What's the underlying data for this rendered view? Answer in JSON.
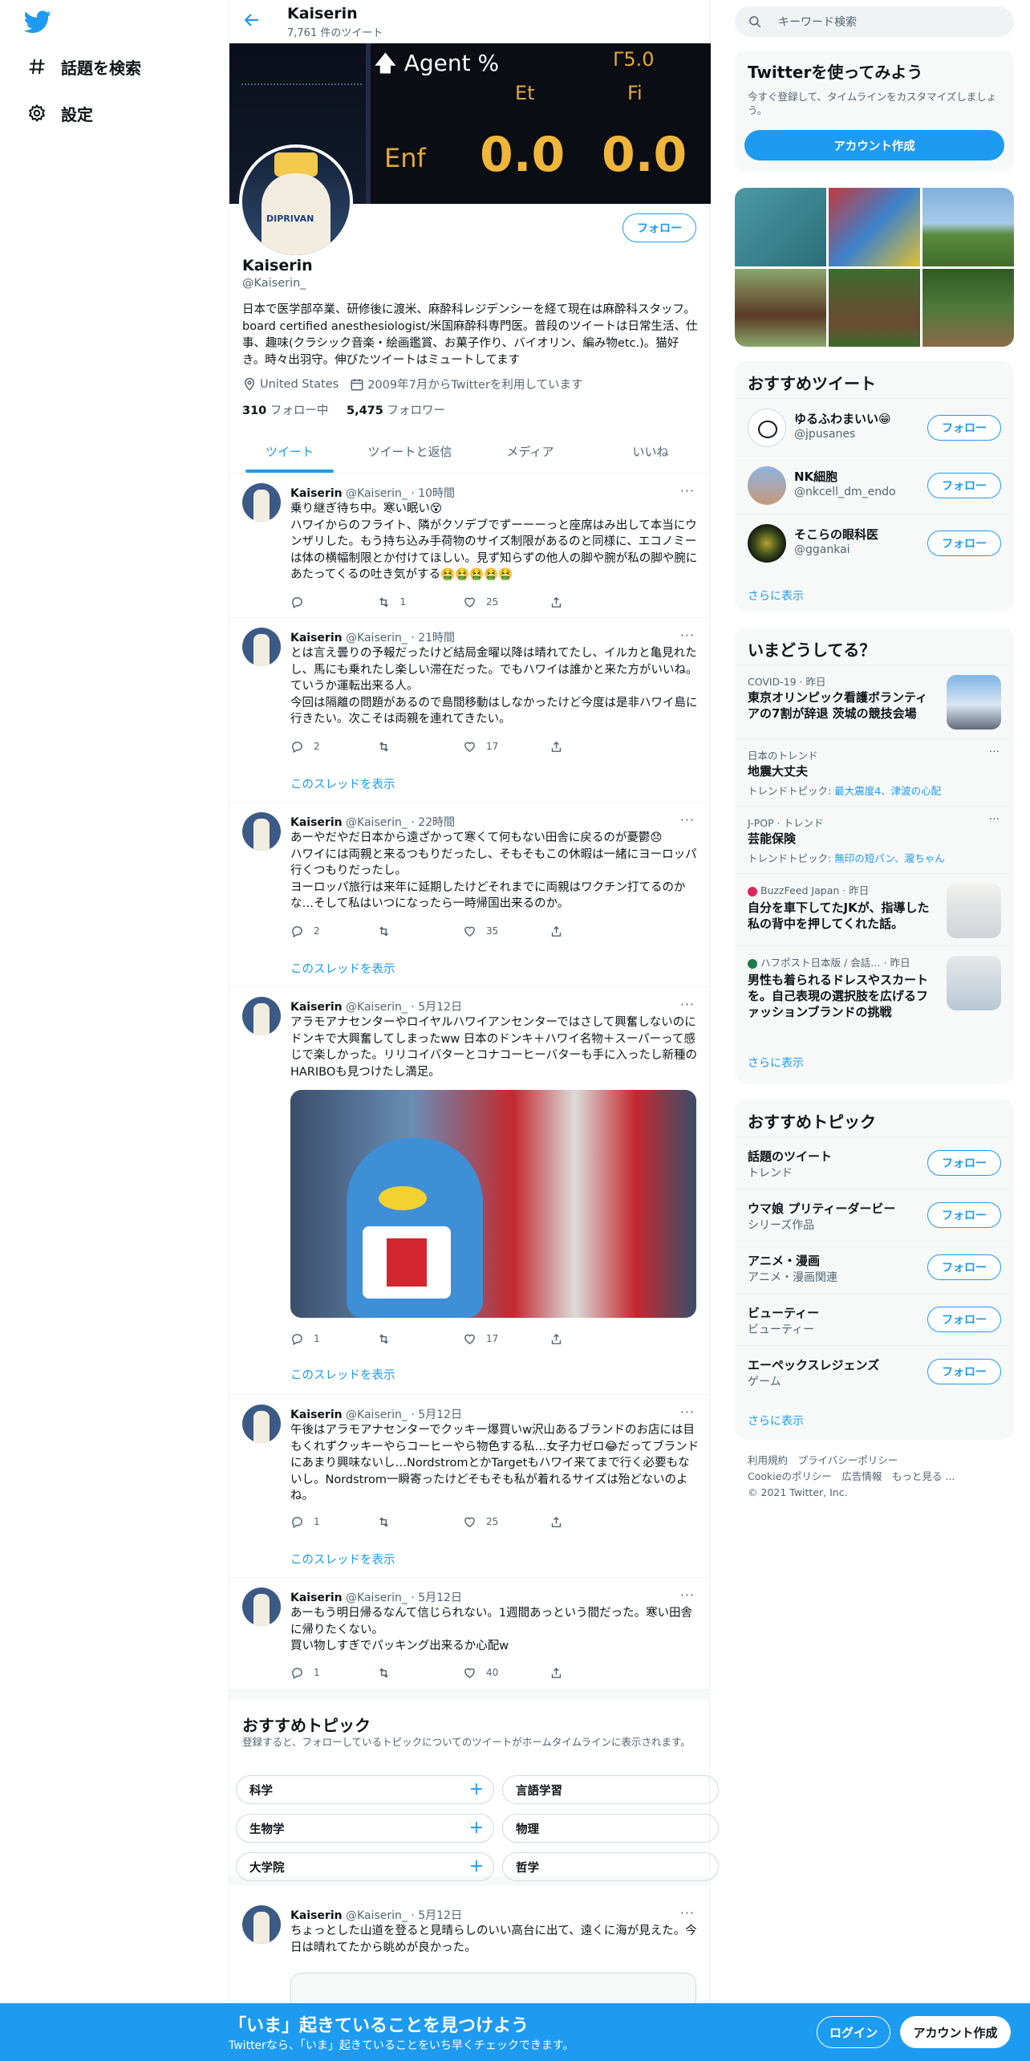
{
  "nav": {
    "explore": "話題を検索",
    "settings": "設定"
  },
  "header": {
    "name": "Kaiserin",
    "tweet_count": "7,761 件のツイート"
  },
  "banner": {
    "agent": "Agent %",
    "et": "Et",
    "fi": "Fi",
    "enf": "Enf",
    "val1": "0.0",
    "val2": "0.0",
    "top": "Γ5.0"
  },
  "profile": {
    "follow": "フォロー",
    "name": "Kaiserin",
    "handle": "@Kaiserin_",
    "bio": "日本で医学部卒業、研修後に渡米、麻酔科レジデンシーを経て現在は麻酔科スタッフ。board certified anesthesiologist/米国麻酔科専門医。普段のツイートは日常生活、仕事、趣味(クラシック音楽・絵画鑑賞、お菓子作り、バイオリン、編み物etc.)。猫好き。時々出羽守。伸びたツイートはミュートしてます",
    "location": "United States",
    "joined": "2009年7月からTwitterを利用しています",
    "following_count": "310",
    "following_label": " フォロー中",
    "followers_count": "5,475",
    "followers_label": " フォロワー",
    "avatar_label": "DIPRIVAN"
  },
  "tabs": [
    "ツイート",
    "ツイートと返信",
    "メディア",
    "いいね"
  ],
  "tweets": [
    {
      "name": "Kaiserin",
      "meta": " @Kaiserin_ · 10時間",
      "text": "乗り継ぎ待ち中。寒い眠い😵\nハワイからのフライト、隣がクソデブでずーーーっと座席はみ出して本当にウンザリした。もう持ち込み手荷物のサイズ制限があるのと同様に、エコノミーは体の横幅制限とか付けてほしい。見ず知らずの他人の脚や腕が私の脚や腕にあたってくるの吐き気がする🤮🤮🤮🤮🤮",
      "reply": "",
      "rt": "1",
      "like": "25",
      "thread": ""
    },
    {
      "name": "Kaiserin",
      "meta": " @Kaiserin_ · 21時間",
      "text": "とは言え曇りの予報だったけど結局金曜以降は晴れてたし、イルカと亀見れたし、馬にも乗れたし楽しい滞在だった。でもハワイは誰かと来た方がいいね。ていうか運転出来る人。\n今回は隔離の問題があるので島間移動はしなかったけど今度は是非ハワイ島に行きたい。次こそは両親を連れてきたい。",
      "reply": "2",
      "rt": "",
      "like": "17",
      "thread": "このスレッドを表示"
    },
    {
      "name": "Kaiserin",
      "meta": " @Kaiserin_ · 22時間",
      "text": "あーやだやだ日本から遠ざかって寒くて何もない田舎に戻るのが憂鬱😞\nハワイには両親と来るつもりだったし、そもそもこの休暇は一緒にヨーロッパ行くつもりだったし。\nヨーロッパ旅行は来年に延期したけどそれまでに両親はワクチン打てるのかな…そして私はいつになったら一時帰国出来るのか。",
      "reply": "2",
      "rt": "",
      "like": "35",
      "thread": "このスレッドを表示"
    },
    {
      "name": "Kaiserin",
      "meta": " @Kaiserin_ · 5月12日",
      "text": "アラモアナセンターやロイヤルハワイアンセンターではさして興奮しないのにドンキで大興奮してしまったww 日本のドンキ＋ハワイ名物＋スーパーって感じで楽しかった。リリコイバターとコナコーヒーバターも手に入ったし新種のHARIBOも見つけたし満足。",
      "reply": "1",
      "rt": "",
      "like": "17",
      "thread": "このスレッドを表示"
    },
    {
      "name": "Kaiserin",
      "meta": " @Kaiserin_ · 5月12日",
      "text": "午後はアラモアナセンターでクッキー爆買いw沢山あるブランドのお店には目もくれずクッキーやらコーヒーやら物色する私…女子力ゼロ😂だってブランドにあまり興味ないし…NordstromとかTargetもハワイ来てまで行く必要もないし。Nordstrom一瞬寄ったけどそもそも私が着れるサイズは殆どないのよね。",
      "reply": "1",
      "rt": "",
      "like": "25",
      "thread": "このスレッドを表示"
    },
    {
      "name": "Kaiserin",
      "meta": " @Kaiserin_ · 5月12日",
      "text": "あーもう明日帰るなんて信じられない。1週間あっという間だった。寒い田舎に帰りたくない。\n買い物しすぎでパッキング出来るか心配w",
      "reply": "1",
      "rt": "",
      "like": "40",
      "thread": ""
    },
    {
      "name": "Kaiserin",
      "meta": " @Kaiserin_ · 5月12日",
      "text": "ちょっとした山道を登ると見晴らしのいい高台に出て、遠くに海が見えた。今日は晴れてたから眺めが良かった。",
      "reply": "",
      "rt": "",
      "like": "",
      "thread": ""
    }
  ],
  "topics_inline": {
    "title": "おすすめトピック",
    "subtitle": "登録すると、フォローしているトピックについてのツイートがホームタイムラインに表示されます。",
    "items": [
      "科学",
      "言語学習",
      "生物学",
      "物理",
      "大学院",
      "哲学"
    ]
  },
  "right": {
    "search_placeholder": "キーワード検索",
    "signup": {
      "title": "Twitterを使ってみよう",
      "desc": "今すぐ登録して、タイムラインをカスタマイズしましょう。",
      "button": "アカウント作成"
    },
    "recs": {
      "title": "おすすめツイート",
      "items": [
        {
          "name": "ゆるふわまいい😁",
          "handle": "@jpusanes"
        },
        {
          "name": "NK細胞",
          "handle": "@nkcell_dm_endo"
        },
        {
          "name": "そこらの眼科医",
          "handle": "@ggankai"
        }
      ],
      "more": "さらに表示",
      "follow": "フォロー"
    },
    "trends": {
      "title": "いまどうしてる？",
      "items": [
        {
          "cat": "COVID-19 · 昨日",
          "title": "東京オリンピック看護ボランティアの7割が辞退 茨城の競技会場",
          "sub": ""
        },
        {
          "cat": "日本のトレンド",
          "title": "地震大丈夫",
          "sub_prefix": "トレンドトピック: ",
          "sub": "最大震度4、津波の心配"
        },
        {
          "cat": "J-POP · トレンド",
          "title": "芸能保険",
          "sub_prefix": "トレンドトピック: ",
          "sub": "無印の短パン、瀧ちゃん"
        },
        {
          "cat": "BuzzFeed Japan · 昨日",
          "title": "自分を車下してたJKが、指導した私の背中を押してくれた話。",
          "sub": ""
        },
        {
          "cat": "ハフポスト日本版 / 会話… · 昨日",
          "title": "男性も着られるドレスやスカートを。自己表現の選択肢を広げるファッションブランドの挑戦",
          "sub": ""
        }
      ],
      "more": "さらに表示"
    },
    "topics": {
      "title": "おすすめトピック",
      "items": [
        {
          "name": "話題のツイート",
          "cat": "トレンド"
        },
        {
          "name": "ウマ娘 プリティーダービー",
          "cat": "シリーズ作品"
        },
        {
          "name": "アニメ・漫画",
          "cat": "アニメ・漫画関連"
        },
        {
          "name": "ビューティー",
          "cat": "ビューティー"
        },
        {
          "name": "エーペックスレジェンズ",
          "cat": "ゲーム"
        }
      ],
      "more": "さらに表示",
      "follow": "フォロー"
    },
    "footer": {
      "line1": "利用規約　プライバシーポリシー",
      "line2": "Cookieのポリシー　広告情報　もっと見る ...",
      "line3": "© 2021 Twitter, Inc."
    }
  },
  "bottom": {
    "headline": "「いま」起きていることを見つけよう",
    "sub": "Twitterなら、「いま」起きていることをいち早くチェックできます。",
    "login": "ログイン",
    "signup": "アカウント作成"
  },
  "colors": {
    "accent": "#1d9bf0",
    "text": "#0f1419",
    "muted": "#536471"
  }
}
